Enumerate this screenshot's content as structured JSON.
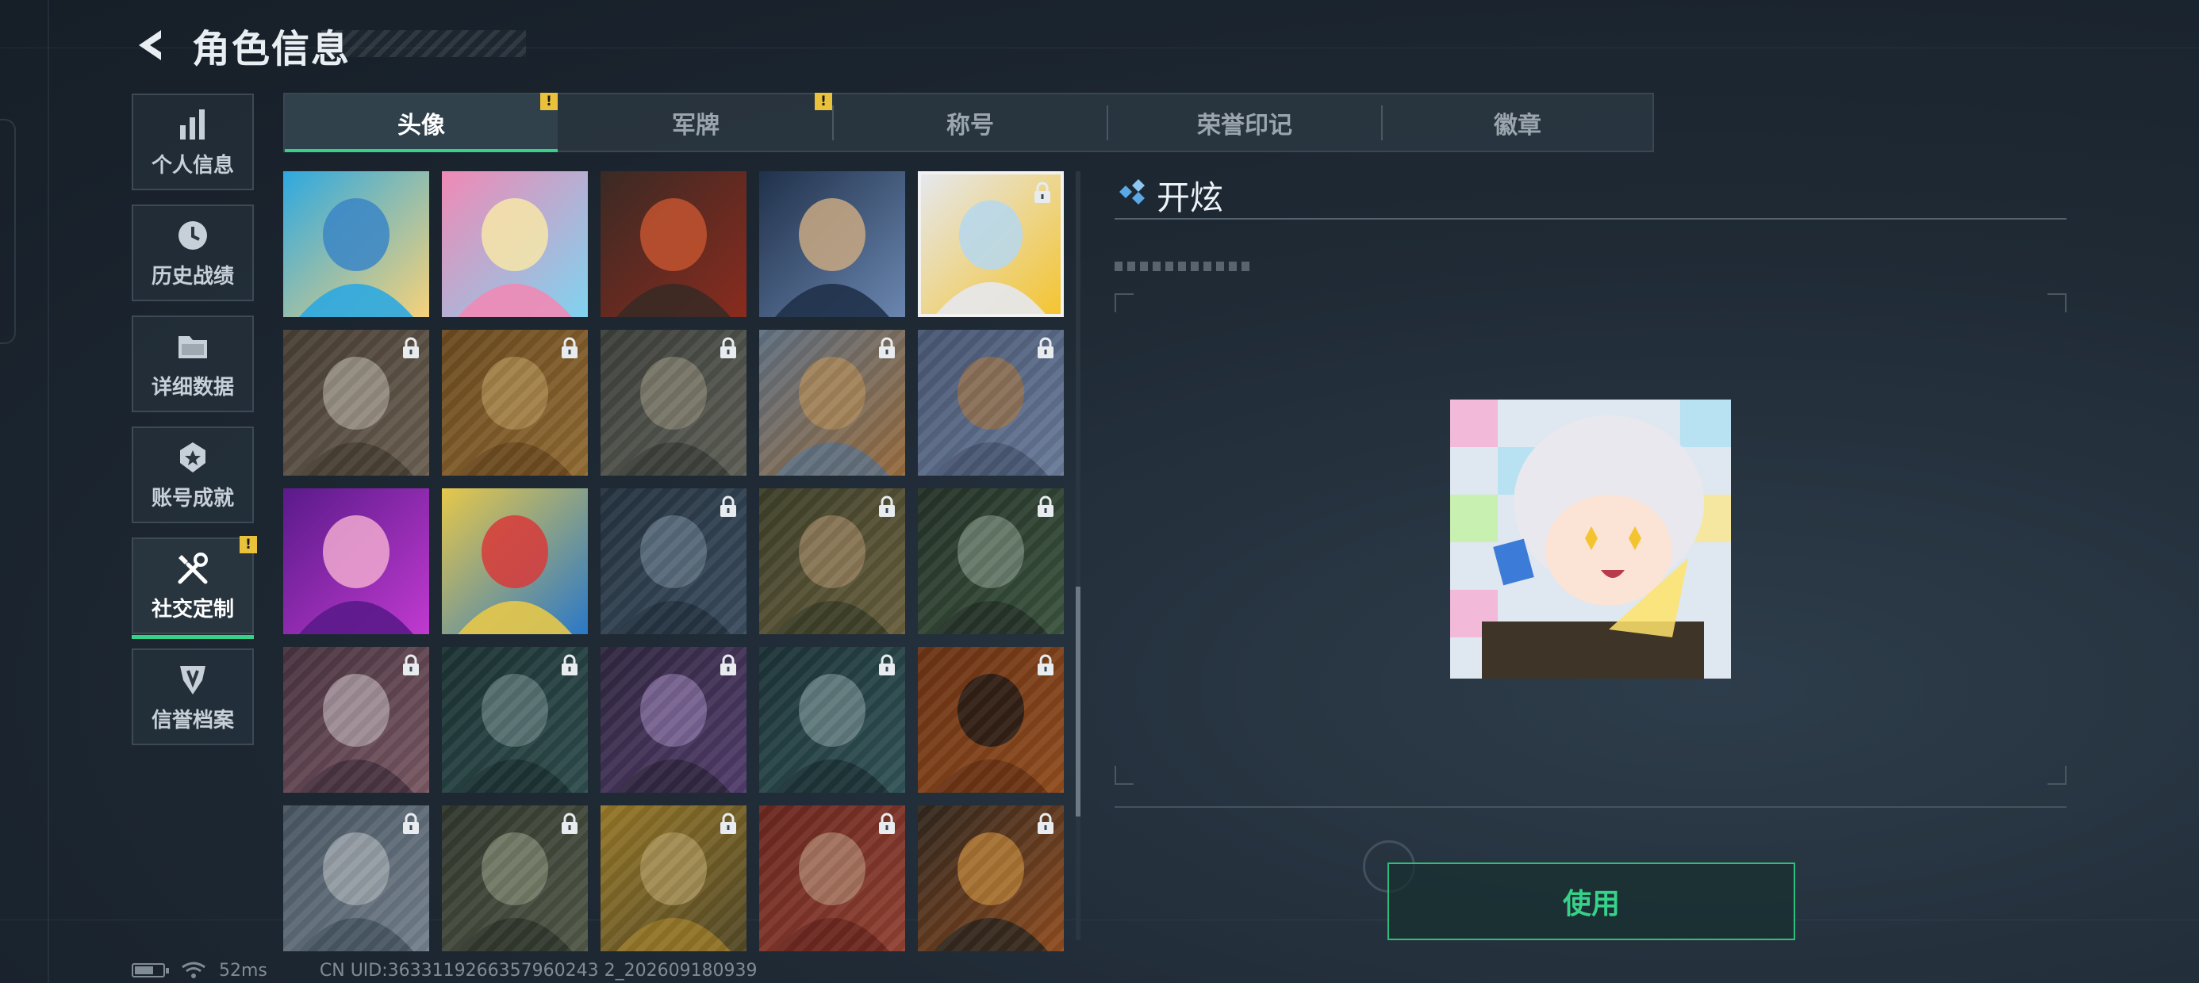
{
  "header": {
    "title": "角色信息"
  },
  "nav": {
    "items": [
      {
        "label": "个人信息",
        "icon": "bar-chart-icon"
      },
      {
        "label": "历史战绩",
        "icon": "history-clock-icon"
      },
      {
        "label": "详细数据",
        "icon": "folder-icon"
      },
      {
        "label": "账号成就",
        "icon": "achievement-star-icon"
      },
      {
        "label": "社交定制",
        "icon": "tools-icon",
        "active": true,
        "badge": "!"
      },
      {
        "label": "信誉档案",
        "icon": "credit-shield-icon"
      }
    ]
  },
  "tabs": [
    {
      "label": "头像",
      "active": true,
      "badge": "!"
    },
    {
      "label": "军牌",
      "badge": "!"
    },
    {
      "label": "称号"
    },
    {
      "label": "荣誉印记"
    },
    {
      "label": "徽章"
    }
  ],
  "avatars": [
    {
      "name": "surfer-boy-avatar",
      "locked": false
    },
    {
      "name": "flamingo-float-kid-avatar",
      "locked": false
    },
    {
      "name": "armored-soldier-avatar",
      "locked": false
    },
    {
      "name": "detective-camera-avatar",
      "locked": false
    },
    {
      "name": "kaixuan-chibi-avatar",
      "locked": true,
      "selected": true
    },
    {
      "name": "eagle-emblem-avatar",
      "locked": true
    },
    {
      "name": "helmet-noodles-avatar",
      "locked": true
    },
    {
      "name": "soldier-with-dog-avatar",
      "locked": true
    },
    {
      "name": "cartoon-bear-avatar",
      "locked": true
    },
    {
      "name": "fish-creature-avatar",
      "locked": true
    },
    {
      "name": "purple-goggles-woman-avatar",
      "locked": false
    },
    {
      "name": "red-octopus-wave-avatar",
      "locked": false
    },
    {
      "name": "pilot-woman-avatar",
      "locked": true
    },
    {
      "name": "bald-operator-avatar",
      "locked": true
    },
    {
      "name": "headset-operator-avatar",
      "locked": true
    },
    {
      "name": "white-hair-woman-avatar",
      "locked": true
    },
    {
      "name": "bearded-glasses-man-avatar",
      "locked": true
    },
    {
      "name": "purple-hair-woman-avatar",
      "locked": true
    },
    {
      "name": "masked-soldier-avatar",
      "locked": true
    },
    {
      "name": "bandana-mercenary-avatar",
      "locked": true
    },
    {
      "name": "star-gear-emblem-avatar",
      "locked": true
    },
    {
      "name": "helicopter-field-avatar",
      "locked": true
    },
    {
      "name": "helmet-ramen-avatar",
      "locked": true
    },
    {
      "name": "red-hair-woman-avatar",
      "locked": true
    },
    {
      "name": "eri-globe-emblem-avatar",
      "locked": true
    }
  ],
  "detail": {
    "name": "开炫",
    "icon": "diamond-cluster-icon",
    "use_label": "使用"
  },
  "status": {
    "ping": "52ms",
    "uid": "CN UID:3633119266357960243 2_202609180939"
  },
  "colors": {
    "accent": "#36d28a",
    "badge": "#e9c13a",
    "background": "#1c2530"
  }
}
